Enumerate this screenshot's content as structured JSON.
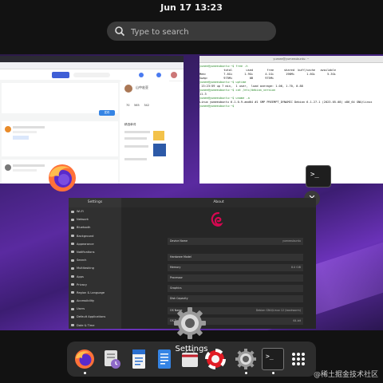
{
  "topbar": {
    "clock": "Jun 17  13:23"
  },
  "search": {
    "placeholder": "Type to search"
  },
  "browser": {
    "title": "",
    "profile_name": "山中宏亚",
    "stats": [
      "70",
      "565",
      "342"
    ],
    "section_title": "精选单词",
    "button_label": "发布"
  },
  "terminal": {
    "title": "yumee@yumeeubuntu: ~",
    "lines": [
      "yumee@yumeeubuntu:~$ free -h",
      "              total        used        free      shared  buff/cache   available",
      "Mem:          7.6Gi       1.9Gi       4.1Gi       196Mi       1.6Gi       5.3Gi",
      "Swap:         975Mi          0B       975Mi",
      "yumee@yumeeubuntu:~$ uptime",
      " 13:23:59 up 7 min,  1 user,  load average: 1.06, 1.70, 0.88",
      "yumee@yumeeubuntu:~$ cat /etc/debian_version",
      "11.3",
      "yumee@yumeeubuntu:~$ uname -a",
      "Linux yumeeubuntu 6.1.0-9-amd64 #1 SMP PREEMPT_DYNAMIC Debian 6.1.27-1 (2023-05-08) x86_64 GNU/Linux",
      "yumee@yumeeubuntu:~$ "
    ]
  },
  "settings": {
    "sidebar_title": "Settings",
    "main_title": "About",
    "sidebar_items": [
      "Wi-Fi",
      "Network",
      "Bluetooth",
      "Background",
      "Appearance",
      "Notifications",
      "Search",
      "Multitasking",
      "Apps",
      "Privacy",
      "Online Accounts",
      "Sharing",
      "Sound",
      "Power",
      "Displays",
      "Mouse & Touchpad",
      "Keyboard",
      "Printers",
      "Removable Media",
      "Color",
      "Region & Language",
      "Accessibility",
      "Users",
      "Default Applications",
      "Date & Time",
      "About"
    ],
    "active_item": "About",
    "rows": [
      {
        "k": "Device Name",
        "v": "yumeeubuntu"
      },
      {
        "k": "Hardware Model",
        "v": ""
      },
      {
        "k": "Memory",
        "v": "8.0 GiB"
      },
      {
        "k": "Processor",
        "v": ""
      },
      {
        "k": "Graphics",
        "v": ""
      },
      {
        "k": "Disk Capacity",
        "v": ""
      },
      {
        "k": "OS Name",
        "v": "Debian GNU/Linux 12 (bookworm)"
      },
      {
        "k": "OS Type",
        "v": "64-bit"
      },
      {
        "k": "GNOME Version",
        "v": ""
      }
    ]
  },
  "focused_app_label": "Settings",
  "dock": {
    "items": [
      "firefox",
      "files",
      "libreoffice-writer",
      "text-editor",
      "software",
      "help",
      "settings",
      "terminal",
      "app-grid"
    ],
    "running": [
      "firefox",
      "settings",
      "terminal"
    ]
  },
  "watermark": "@稀土掘金技术社区",
  "colors": {
    "accent": "#3584e4",
    "dock": "#2d2d2d",
    "wallpaper": "#5a2aa0"
  }
}
